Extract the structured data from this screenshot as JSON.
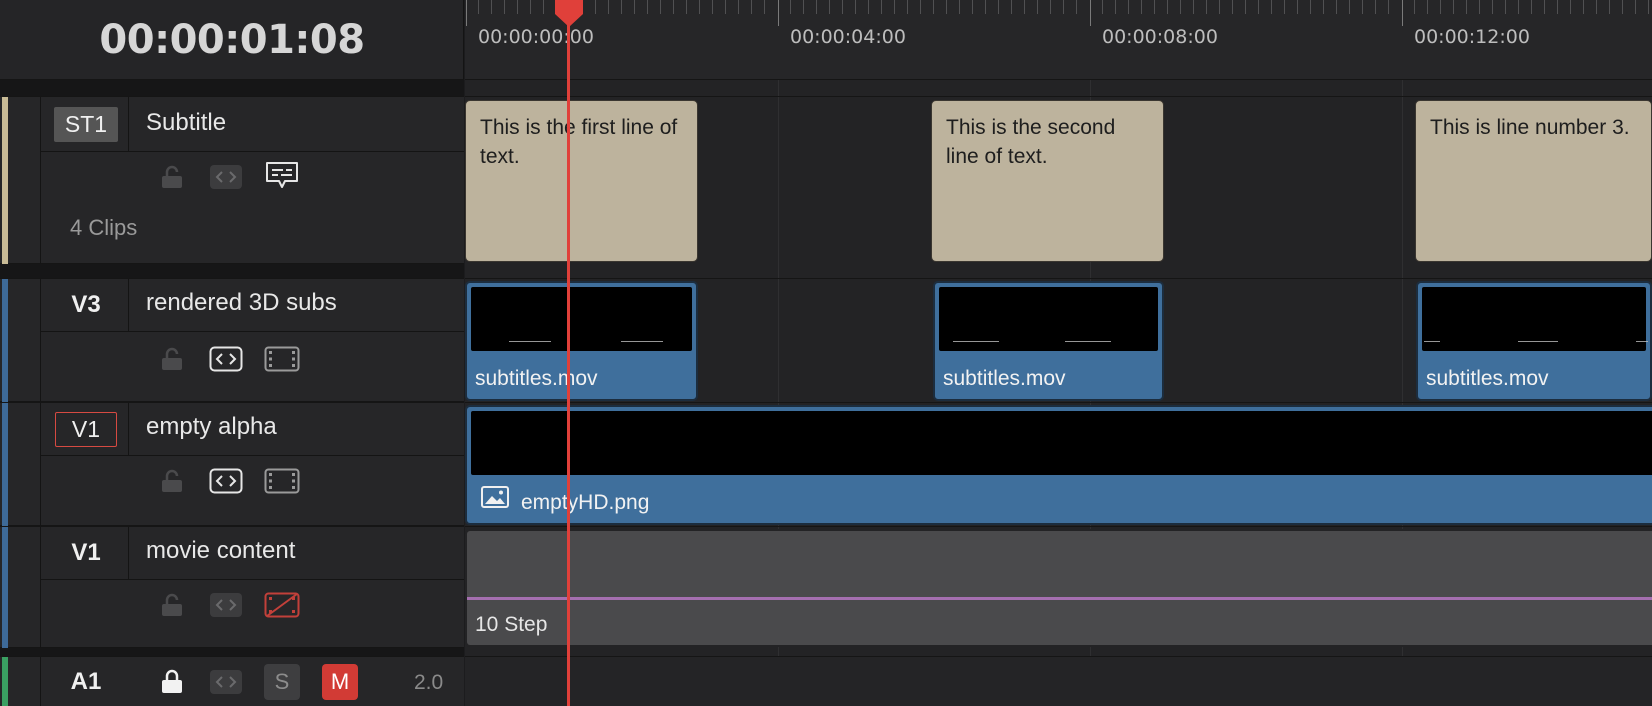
{
  "timecode": "00:00:01:08",
  "ruler": {
    "labels": [
      "00:00:00:00",
      "00:00:04:00",
      "00:00:08:00",
      "00:00:12:00"
    ]
  },
  "tracks": {
    "subtitle": {
      "id": "ST1",
      "name": "Subtitle",
      "clip_count": "4 Clips",
      "color": "#c9bb96",
      "clips": [
        {
          "text": "This is the first line of text."
        },
        {
          "text": "This is the second line of text."
        },
        {
          "text": "This is line number 3."
        }
      ]
    },
    "v3": {
      "id": "V3",
      "name": "rendered 3D subs",
      "color": "#3e6a98",
      "clips": [
        {
          "label": "subtitles.mov"
        },
        {
          "label": "subtitles.mov"
        },
        {
          "label": "subtitles.mov"
        }
      ]
    },
    "v1_alpha": {
      "id": "V1",
      "name": "empty alpha",
      "color": "#3e6a98",
      "clip_label": "emptyHD.png"
    },
    "v1_movie": {
      "id": "V1",
      "name": "movie content",
      "color": "#3e6a98",
      "clip_label": "10 Step"
    },
    "a1": {
      "id": "A1",
      "solo_label": "S",
      "mute_label": "M",
      "channels": "2.0",
      "color": "#3aa062"
    }
  },
  "icons": [
    "lock-icon",
    "auto-select-icon",
    "subtitle-enable-icon",
    "video-enable-icon",
    "video-disabled-icon",
    "image-icon",
    "playhead-marker-icon"
  ],
  "colors": {
    "playhead": "#e0403a",
    "video_clip": "#3f6f9c",
    "subtitle_clip": "#bdb39d",
    "mute_active": "#d23b35"
  }
}
